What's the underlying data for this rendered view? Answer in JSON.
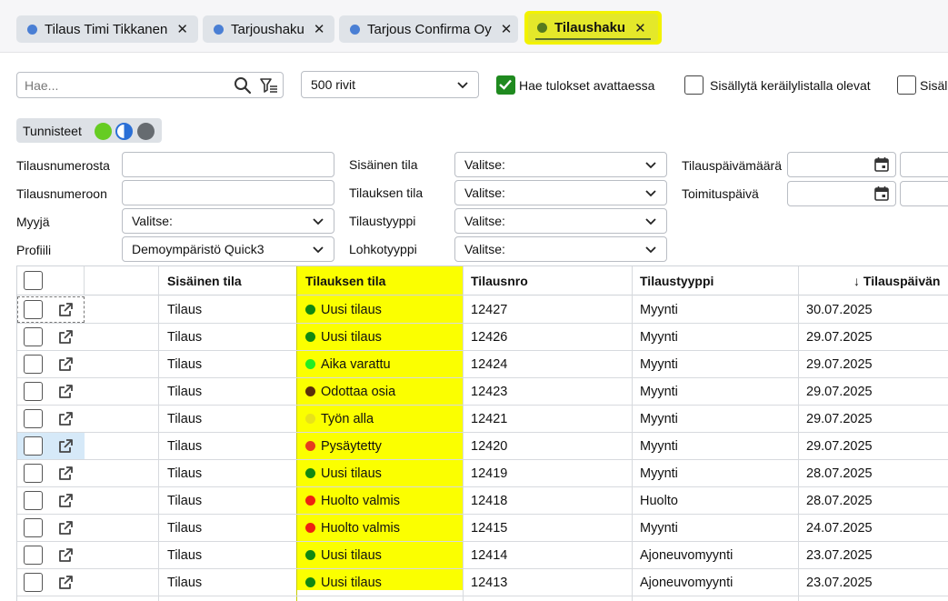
{
  "tabs": [
    {
      "label": "Tilaus Timi Tikkanen",
      "dot_color": "#4a7fd4",
      "active": false
    },
    {
      "label": "Tarjoushaku",
      "dot_color": "#4a7fd4",
      "active": false
    },
    {
      "label": "Tarjous Confirma Oy",
      "dot_color": "#4a7fd4",
      "active": false
    },
    {
      "label": "Tilaushaku",
      "dot_color": "#557a1f",
      "active": true
    }
  ],
  "toolbar": {
    "search_placeholder": "Hae...",
    "rows_select": "500 rivit",
    "auto_search_label": "Hae tulokset avattaessa",
    "auto_search_checked": true,
    "include_picking_label": "Sisällytä keräilylistalla olevat",
    "include_picking_checked": false,
    "include_other_label": "Sisäl",
    "include_other_checked": false
  },
  "tags": {
    "label": "Tunnisteet",
    "colors": [
      "#66cc22",
      "#2a6fd6",
      "#666b70"
    ]
  },
  "filters": {
    "order_from_label": "Tilausnumerosta",
    "order_to_label": "Tilausnumeroon",
    "seller_label": "Myyjä",
    "seller_value": "Valitse:",
    "profile_label": "Profiili",
    "profile_value": "Demoympäristö Quick3",
    "internal_state_label": "Sisäinen tila",
    "internal_state_value": "Valitse:",
    "order_state_label": "Tilauksen tila",
    "order_state_value": "Valitse:",
    "order_type_label": "Tilaustyyppi",
    "order_type_value": "Valitse:",
    "block_type_label": "Lohkotyyppi",
    "block_type_value": "Valitse:",
    "order_date_label": "Tilauspäivämäärä",
    "delivery_date_label": "Toimituspäivä"
  },
  "table": {
    "columns": [
      "",
      "",
      "Sisäinen tila",
      "Tilauksen tila",
      "Tilausnro",
      "Tilaustyyppi",
      "↓ Tilauspäivän"
    ],
    "rows": [
      {
        "internal": "Tilaus",
        "status": "Uusi tilaus",
        "status_color": "#118811",
        "number": "12427",
        "type": "Myynti",
        "date": "30.07.2025"
      },
      {
        "internal": "Tilaus",
        "status": "Uusi tilaus",
        "status_color": "#118811",
        "number": "12426",
        "type": "Myynti",
        "date": "29.07.2025"
      },
      {
        "internal": "Tilaus",
        "status": "Aika varattu",
        "status_color": "#22ee22",
        "number": "12424",
        "type": "Myynti",
        "date": "29.07.2025"
      },
      {
        "internal": "Tilaus",
        "status": "Odottaa osia",
        "status_color": "#5a2e0a",
        "number": "12423",
        "type": "Myynti",
        "date": "29.07.2025"
      },
      {
        "internal": "Tilaus",
        "status": "Työn alla",
        "status_color": "#e8e21a",
        "number": "12421",
        "type": "Myynti",
        "date": "29.07.2025"
      },
      {
        "internal": "Tilaus",
        "status": "Pysäytetty",
        "status_color": "#e63c1e",
        "number": "12420",
        "type": "Myynti",
        "date": "29.07.2025"
      },
      {
        "internal": "Tilaus",
        "status": "Uusi tilaus",
        "status_color": "#118811",
        "number": "12419",
        "type": "Myynti",
        "date": "28.07.2025"
      },
      {
        "internal": "Tilaus",
        "status": "Huolto valmis",
        "status_color": "#ee2211",
        "number": "12418",
        "type": "Huolto",
        "date": "28.07.2025"
      },
      {
        "internal": "Tilaus",
        "status": "Huolto valmis",
        "status_color": "#ee2211",
        "number": "12415",
        "type": "Myynti",
        "date": "24.07.2025"
      },
      {
        "internal": "Tilaus",
        "status": "Uusi tilaus",
        "status_color": "#118811",
        "number": "12414",
        "type": "Ajoneuvomyynti",
        "date": "23.07.2025"
      },
      {
        "internal": "Tilaus",
        "status": "Uusi tilaus",
        "status_color": "#118811",
        "number": "12413",
        "type": "Ajoneuvomyynti",
        "date": "23.07.2025"
      }
    ]
  }
}
